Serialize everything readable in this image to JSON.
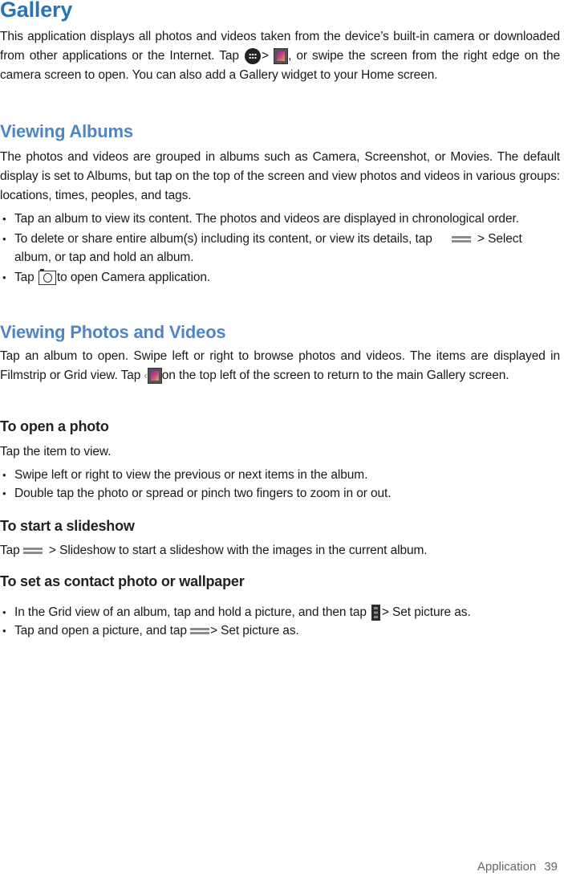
{
  "title": "Gallery",
  "intro": {
    "part1": "This application displays all photos and videos taken from the device’s built-in camera or downloaded from other applications or the Internet. Tap",
    "icon1": "apps-icon",
    "sep": ">",
    "icon2": "gallery-icon",
    "part2": ", or swipe the screen from the right edge on the camera screen to open. You can also add a Gallery widget to your Home screen."
  },
  "viewing_albums": {
    "heading": "Viewing Albums",
    "body": "The photos and videos are grouped in albums such as Camera, Screenshot, or Movies. The default display is set to Albums, but tap on the top of the screen and view photos and videos in various groups: locations, times, peoples, and  tags.",
    "bullets": [
      {
        "text": "Tap an album to view its content. The photos and videos are displayed in chronological order."
      },
      {
        "pre": "To delete or share entire album(s) including its content, or view its details, tap",
        "icon": "menu-icon",
        "post": "> Select album, or tap and hold an  album."
      },
      {
        "pre": "Tap",
        "icon": "camera-icon",
        "post": "to open Camera application."
      }
    ]
  },
  "viewing_photos": {
    "heading": "Viewing Photos and Videos",
    "pre": "Tap an album to open. Swipe left or right to browse photos and videos. The items are displayed in Filmstrip or Grid view. Tap",
    "icon": "back-gallery-icon",
    "back_glyph": "‹",
    "post": "on the top left of the screen to return to the main Gallery screen."
  },
  "open_photo": {
    "heading": "To open a photo",
    "body": "Tap the item to view.",
    "bullets": [
      "Swipe left or right to view the previous or next items in the  album.",
      "Double tap the photo or spread or pinch two fingers to zoom in or  out."
    ]
  },
  "slideshow": {
    "heading": "To start a slideshow",
    "pre": "Tap",
    "icon": "menu-icon",
    "post": "> Slideshow to start a slideshow with the images in the current  album."
  },
  "set_as": {
    "heading": "To set as contact photo or  wallpaper",
    "bullets": [
      {
        "pre": "In the Grid view of an album, tap and hold a picture, and then tap",
        "icon": "overflow-icon",
        "post": "> Set picture  as."
      },
      {
        "pre": "Tap and open a picture, and tap",
        "icon": "menu-icon",
        "post": "> Set picture  as."
      }
    ]
  },
  "footer": {
    "section": "Application",
    "page": "39"
  }
}
